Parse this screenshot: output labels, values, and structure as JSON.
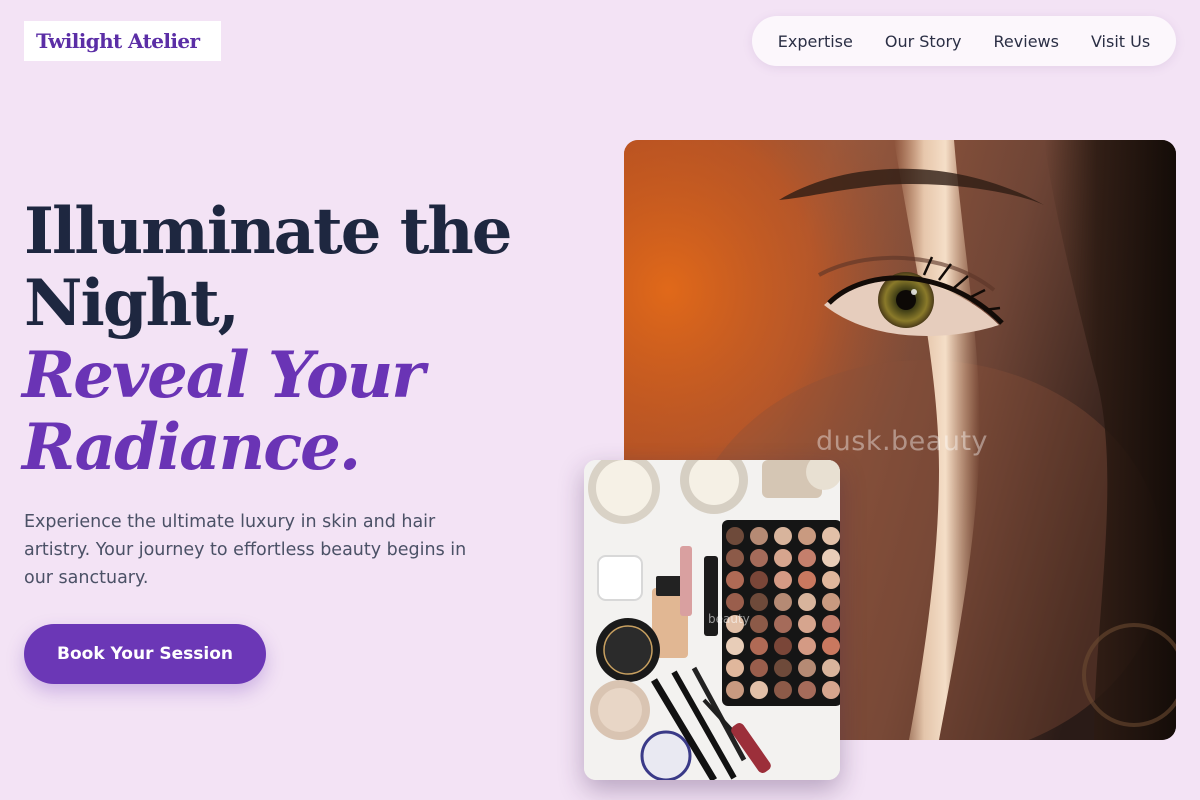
{
  "brand": {
    "name": "Twilight Atelier"
  },
  "nav": {
    "items": [
      "Expertise",
      "Our Story",
      "Reviews",
      "Visit Us"
    ]
  },
  "hero": {
    "headline_line1": "Illuminate the",
    "headline_line2": "Night,",
    "headline_accent_line1": "Reveal Your",
    "headline_accent_line2": "Radiance.",
    "subtext": "Experience the ultimate luxury in skin and hair artistry. Your journey to effortless beauty begins in our sanctuary.",
    "cta_label": "Book Your Session"
  },
  "images": {
    "main_watermark": "dusk.beauty",
    "small_watermark": "beauty"
  },
  "colors": {
    "background": "#f3e3f5",
    "accent": "#6a34b5",
    "headline": "#1e2740",
    "button": "#6b37b6"
  }
}
